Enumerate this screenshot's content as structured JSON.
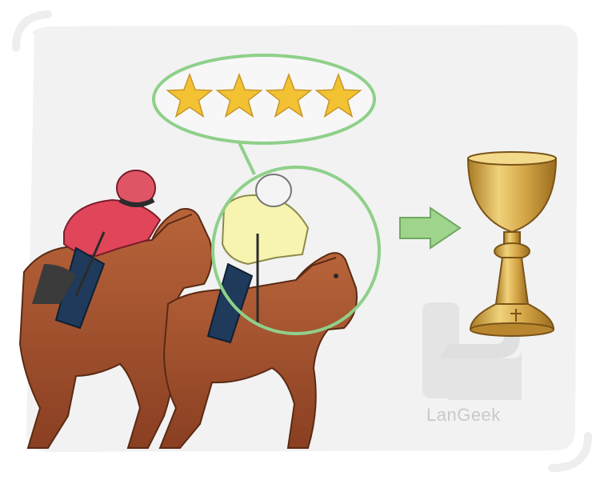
{
  "illustration": {
    "subject": "horse-race-illustration",
    "rating": {
      "stars": 4,
      "max": 4
    },
    "arrow": "right-arrow-icon",
    "trophy": "chalice-icon",
    "colors": {
      "background_panel": "#f2f2f2",
      "highlight_ring": "#8fd08a",
      "star": "#f2c232",
      "arrow": "#9fd48d",
      "horse": "#a5532f",
      "jockey_back_silks": "#e0455a",
      "jockey_front_silks": "#f7f4b0",
      "chalice_gold": "#c99a3b"
    }
  },
  "watermark": {
    "text": "LanGeek"
  }
}
